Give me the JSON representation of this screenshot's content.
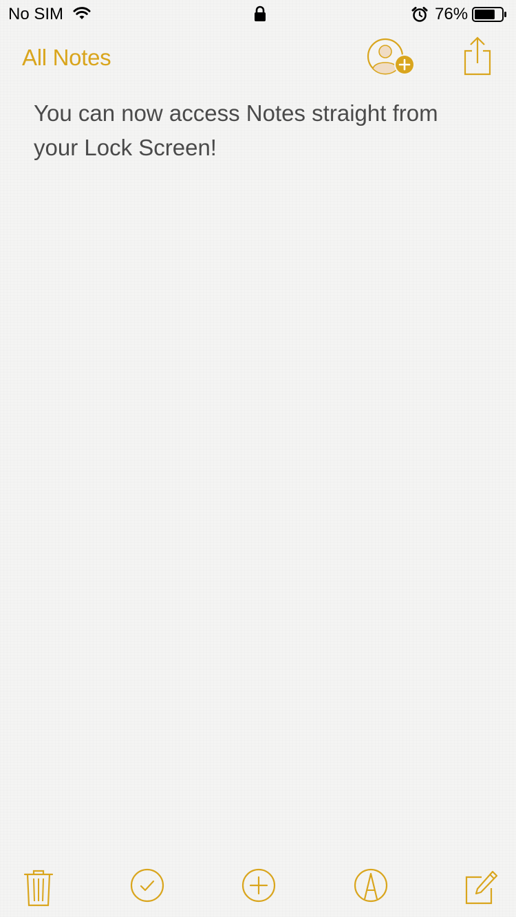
{
  "status_bar": {
    "carrier": "No SIM",
    "battery_percent": "76%",
    "battery_level": 0.76,
    "icons": [
      "wifi-icon",
      "lock-icon",
      "alarm-icon",
      "battery-icon"
    ]
  },
  "nav": {
    "back_label": "All Notes",
    "icons": [
      "add-people-icon",
      "share-icon"
    ]
  },
  "note": {
    "text": "You can now access Notes straight from your Lock Screen!"
  },
  "toolbar": {
    "icons": [
      "trash-icon",
      "checklist-icon",
      "add-icon",
      "markup-icon",
      "compose-icon"
    ]
  },
  "colors": {
    "accent": "#d9a51d",
    "text": "#4a4a4a",
    "background": "#f4f4f3"
  }
}
